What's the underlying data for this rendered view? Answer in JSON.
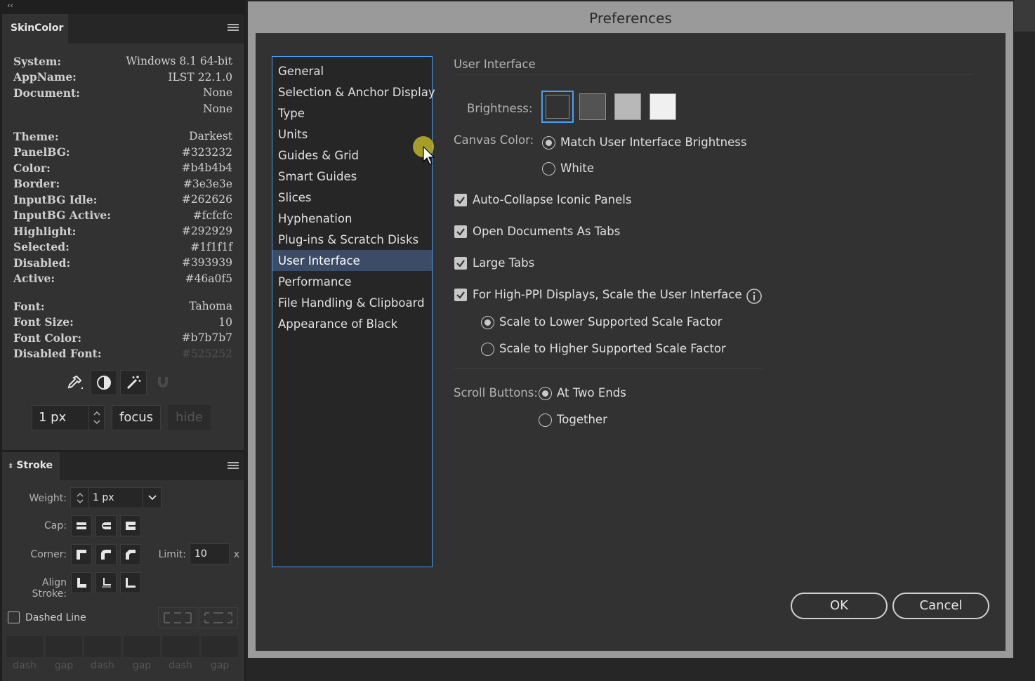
{
  "skin_panel": {
    "tab_label": "SkinColor",
    "info_rows": [
      {
        "key": "System:",
        "value": "Windows 8.1 64-bit"
      },
      {
        "key": "AppName:",
        "value": "ILST 22.1.0"
      },
      {
        "key": "Document:",
        "value": "None"
      },
      {
        "key": "",
        "value": "None"
      }
    ],
    "theme_rows": [
      {
        "key": "Theme:",
        "value": "Darkest"
      },
      {
        "key": "PanelBG:",
        "value": "#323232"
      },
      {
        "key": "Color:",
        "value": "#b4b4b4"
      },
      {
        "key": "Border:",
        "value": "#3e3e3e"
      },
      {
        "key": "InputBG Idle:",
        "value": "#262626"
      },
      {
        "key": "InputBG Active:",
        "value": "#fcfcfc"
      },
      {
        "key": "Highlight:",
        "value": "#292929"
      },
      {
        "key": "Selected:",
        "value": "#1f1f1f"
      },
      {
        "key": "Disabled:",
        "value": "#393939"
      },
      {
        "key": "Active:",
        "value": "#46a0f5"
      }
    ],
    "font_rows": [
      {
        "key": "Font:",
        "value": "Tahoma"
      },
      {
        "key": "Font Size:",
        "value": "10"
      },
      {
        "key": "Font Color:",
        "value": "#b7b7b7"
      },
      {
        "key": "Disabled Font:",
        "value": "#525252"
      }
    ],
    "px_value": "1 px",
    "focus_label": "focus",
    "hide_label": "hide"
  },
  "stroke_panel": {
    "tab_label": "Stroke",
    "weight_label": "Weight:",
    "weight_value": "1 px",
    "cap_label": "Cap:",
    "corner_label": "Corner:",
    "limit_label": "Limit:",
    "limit_value": "10",
    "limit_suffix": "x",
    "align_label": "Align Stroke:",
    "dashed_label": "Dashed Line",
    "dash_labels": [
      "dash",
      "gap",
      "dash",
      "gap",
      "dash",
      "gap"
    ]
  },
  "dialog": {
    "title": "Preferences",
    "categories": [
      "General",
      "Selection & Anchor Display",
      "Type",
      "Units",
      "Guides & Grid",
      "Smart Guides",
      "Slices",
      "Hyphenation",
      "Plug-ins & Scratch Disks",
      "User Interface",
      "Performance",
      "File Handling & Clipboard",
      "Appearance of Black"
    ],
    "selected_category": "User Interface",
    "section_title": "User Interface",
    "brightness_label": "Brightness:",
    "brightness_swatches": [
      "#323232",
      "#535353",
      "#b8b8b8",
      "#f0f0f0"
    ],
    "canvas_label": "Canvas Color:",
    "canvas_options": [
      "Match User Interface Brightness",
      "White"
    ],
    "auto_collapse": "Auto-Collapse Iconic Panels",
    "open_docs_tabs": "Open Documents As Tabs",
    "large_tabs": "Large Tabs",
    "high_ppi": "For High-PPI Displays, Scale the User Interface",
    "scale_options": [
      "Scale to Lower Supported Scale Factor",
      "Scale to Higher Supported Scale Factor"
    ],
    "scroll_label": "Scroll Buttons:",
    "scroll_options": [
      "At Two Ends",
      "Together"
    ],
    "ok_label": "OK",
    "cancel_label": "Cancel"
  }
}
